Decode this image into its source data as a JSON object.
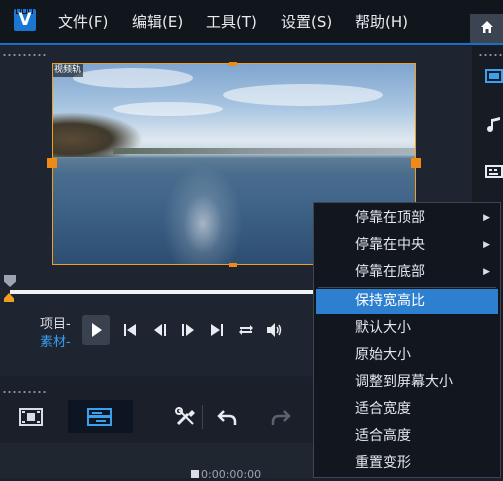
{
  "app": {
    "logo": "V"
  },
  "menubar": {
    "items": [
      {
        "label": "文件(F)"
      },
      {
        "label": "编辑(E)"
      },
      {
        "label": "工具(T)"
      },
      {
        "label": "设置(S)"
      },
      {
        "label": "帮助(H)"
      }
    ]
  },
  "preview": {
    "track_label": "视频轨",
    "mode_project": "项目-",
    "mode_clip": "素材-"
  },
  "timeline": {
    "timecode": "0:00:00:00"
  },
  "context_menu": {
    "items": [
      {
        "label": "停靠在顶部",
        "submenu": true
      },
      {
        "label": "停靠在中央",
        "submenu": true
      },
      {
        "label": "停靠在底部",
        "submenu": true
      },
      {
        "label": "保持宽高比",
        "highlighted": true
      },
      {
        "label": "默认大小"
      },
      {
        "label": "原始大小"
      },
      {
        "label": "调整到屏幕大小"
      },
      {
        "label": "适合宽度"
      },
      {
        "label": "适合高度"
      },
      {
        "label": "重置变形"
      }
    ]
  },
  "colors": {
    "accent": "#2d80d0",
    "handle": "#f08a16",
    "clip_mode": "#3aa0f0"
  }
}
